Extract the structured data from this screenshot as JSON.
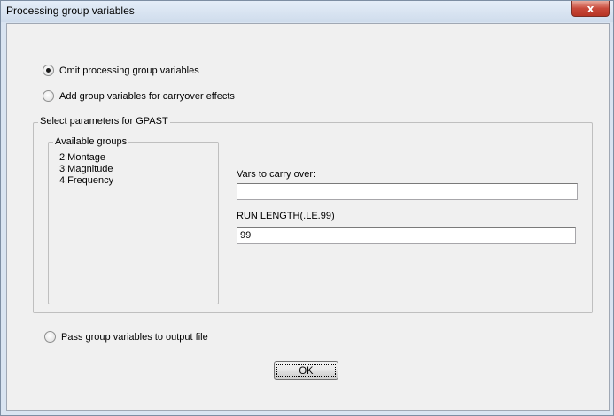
{
  "window": {
    "title": "Processing group variables",
    "close_glyph": "x"
  },
  "options": {
    "omit_label": "Omit processing group variables",
    "add_label": "Add group variables for carryover effects",
    "pass_label": "Pass group variables to output file",
    "selected": "omit"
  },
  "gpast": {
    "legend": "Select parameters for GPAST",
    "available_groups": {
      "legend": "Available groups",
      "items": [
        "2 Montage",
        "3 Magnitude",
        "4 Frequency"
      ]
    },
    "carry_over": {
      "label": "Vars to carry over:",
      "value": ""
    },
    "run_length": {
      "label": "RUN LENGTH(.LE.99)",
      "value": "99"
    }
  },
  "buttons": {
    "ok_label": "OK"
  }
}
